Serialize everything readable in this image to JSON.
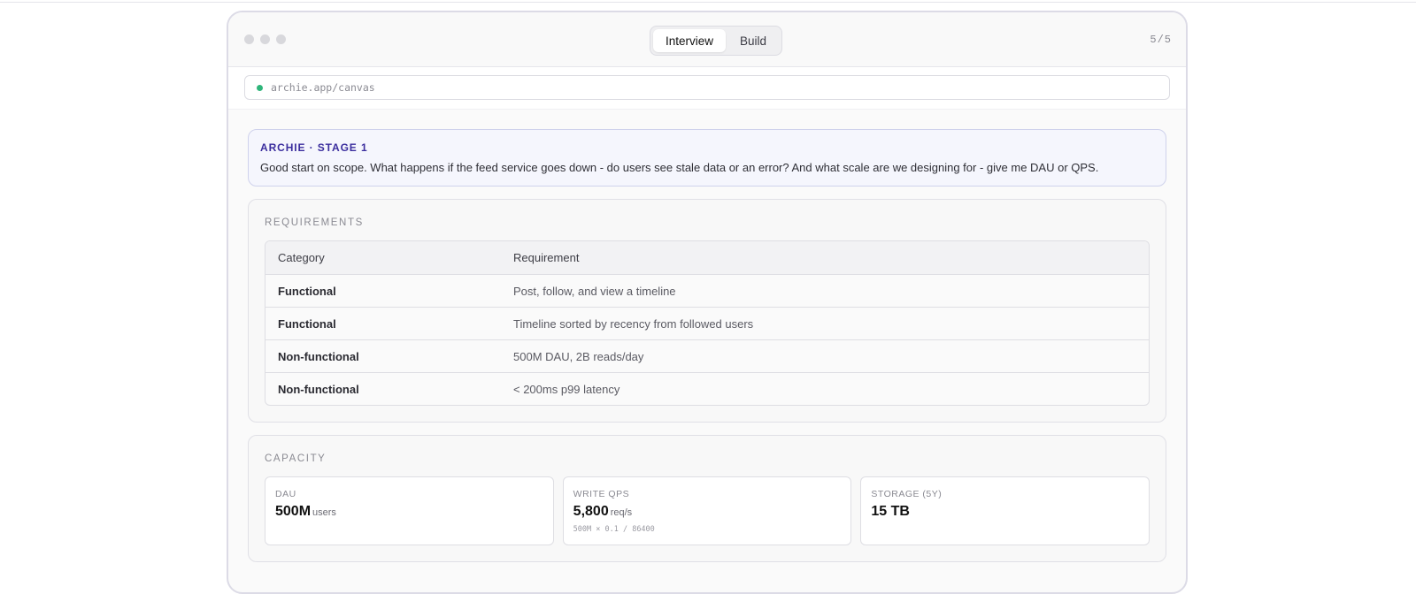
{
  "window": {
    "tabs": [
      {
        "label": "Interview",
        "active": true
      },
      {
        "label": "Build",
        "active": false
      }
    ],
    "step_counter": "5/5",
    "url": "archie.app/canvas"
  },
  "archie": {
    "label": "ARCHIE · STAGE 1",
    "message": "Good start on scope. What happens if the feed service goes down - do users see stale data or an error? And what scale are we designing for - give me DAU or QPS."
  },
  "requirements": {
    "title": "REQUIREMENTS",
    "columns": [
      "Category",
      "Requirement"
    ],
    "rows": [
      {
        "category": "Functional",
        "requirement": "Post, follow, and view a timeline"
      },
      {
        "category": "Functional",
        "requirement": "Timeline sorted by recency from followed users"
      },
      {
        "category": "Non-functional",
        "requirement": "500M DAU, 2B reads/day"
      },
      {
        "category": "Non-functional",
        "requirement": "< 200ms p99 latency"
      }
    ]
  },
  "capacity": {
    "title": "CAPACITY",
    "metrics": [
      {
        "label": "DAU",
        "value": "500M",
        "unit": "users",
        "formula": ""
      },
      {
        "label": "WRITE QPS",
        "value": "5,800",
        "unit": "req/s",
        "formula": "500M × 0.1 / 86400"
      },
      {
        "label": "STORAGE (5Y)",
        "value": "15 TB",
        "unit": "",
        "formula": ""
      }
    ]
  },
  "colors": {
    "accent": "#3b2e9e",
    "status_dot": "#2fb57a"
  }
}
